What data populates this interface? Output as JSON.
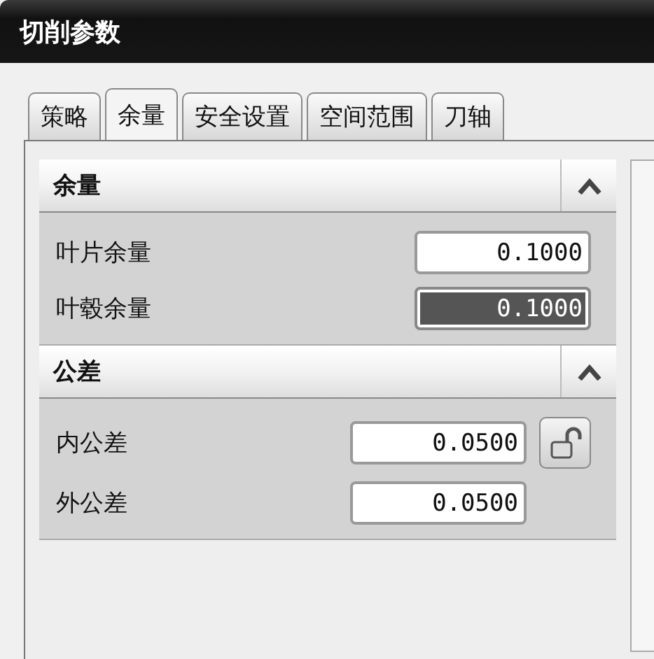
{
  "window": {
    "title": "切削参数"
  },
  "tabs": [
    {
      "label": "策略",
      "selected": false
    },
    {
      "label": "余量",
      "selected": true
    },
    {
      "label": "安全设置",
      "selected": false
    },
    {
      "label": "空间范围",
      "selected": false
    },
    {
      "label": "刀轴",
      "selected": false
    }
  ],
  "sections": [
    {
      "title": "余量",
      "expanded": true,
      "rows": [
        {
          "label": "叶片余量",
          "value": "0.1000",
          "highlighted": false,
          "lock_button": false
        },
        {
          "label": "叶毂余量",
          "value": "0.1000",
          "highlighted": true,
          "lock_button": false
        }
      ]
    },
    {
      "title": "公差",
      "expanded": true,
      "rows": [
        {
          "label": "内公差",
          "value": "0.0500",
          "highlighted": false,
          "lock_button": true
        },
        {
          "label": "外公差",
          "value": "0.0500",
          "highlighted": false,
          "lock_button": false
        }
      ]
    }
  ]
}
